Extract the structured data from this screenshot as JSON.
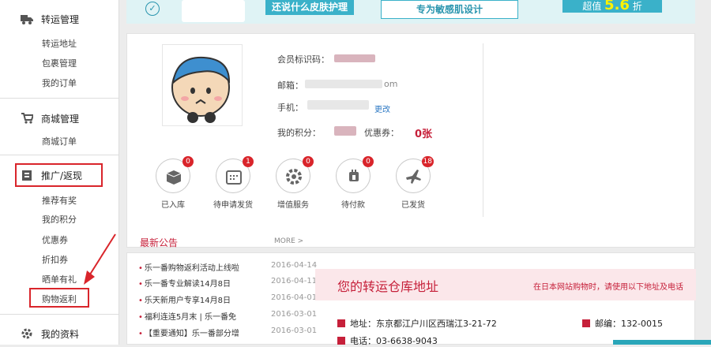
{
  "sidebar": {
    "groups": [
      {
        "title": "转运管理",
        "icon": "truck-icon",
        "items": [
          "转运地址",
          "包裹管理",
          "我的订单"
        ]
      },
      {
        "title": "商城管理",
        "icon": "cart-icon",
        "items": [
          "商城订单"
        ]
      },
      {
        "title": "推广/返现",
        "icon": "promo-icon",
        "items": [
          "推荐有奖",
          "我的积分",
          "优惠券",
          "折扣券",
          "晒单有礼",
          "购物返利"
        ]
      },
      {
        "title": "我的资料",
        "icon": "gear-icon",
        "items": []
      }
    ],
    "highlight_color": "#d9252b"
  },
  "banner": {
    "left_text": "还说什么皮肤护理",
    "mid_text": "专为敏感肌设计",
    "right_prefix": "超值",
    "right_value": "5.6",
    "right_suffix": "折",
    "accent": "#3ab1c9"
  },
  "profile": {
    "member_id_label": "会员标识码：",
    "email_label": "邮箱：",
    "email_suffix": "om",
    "phone_label": "手机：",
    "change_label": "更改",
    "points_label": "我的积分：",
    "coupon_label": "优惠券：",
    "coupon_value": "0张"
  },
  "stats": [
    {
      "label": "已入库",
      "count": "0",
      "icon": "box-icon"
    },
    {
      "label": "待申请发货",
      "count": "1",
      "icon": "calendar-icon"
    },
    {
      "label": "增值服务",
      "count": "0",
      "icon": "gear-icon"
    },
    {
      "label": "待付款",
      "count": "0",
      "icon": "payment-icon"
    },
    {
      "label": "已发货",
      "count": "18",
      "icon": "plane-icon"
    }
  ],
  "news": {
    "title": "最新公告",
    "more": "MORE >",
    "items": [
      {
        "title": "乐一番购物返利活动上线啦",
        "date": "2016-04-14"
      },
      {
        "title": "乐一番专业解读14月8日",
        "date": "2016-04-11"
      },
      {
        "title": "乐天新用户专享14月8日",
        "date": "2016-04-01"
      },
      {
        "title": "福利连连5月末 | 乐一番免",
        "date": "2016-03-01"
      },
      {
        "title": "【重要通知】乐一番部分增",
        "date": "2016-03-01"
      }
    ]
  },
  "warehouse": {
    "title": "您的转运仓库地址",
    "note": "在日本网站购物时，请使用以下地址及电话",
    "address": "地址：东京都江户川区西瑞江3-21-72",
    "postcode": "邮编：132-0015",
    "phone": "电话：03-6638-9043"
  },
  "colors": {
    "brand_red": "#c6203a",
    "link_blue": "#2e79c4"
  }
}
